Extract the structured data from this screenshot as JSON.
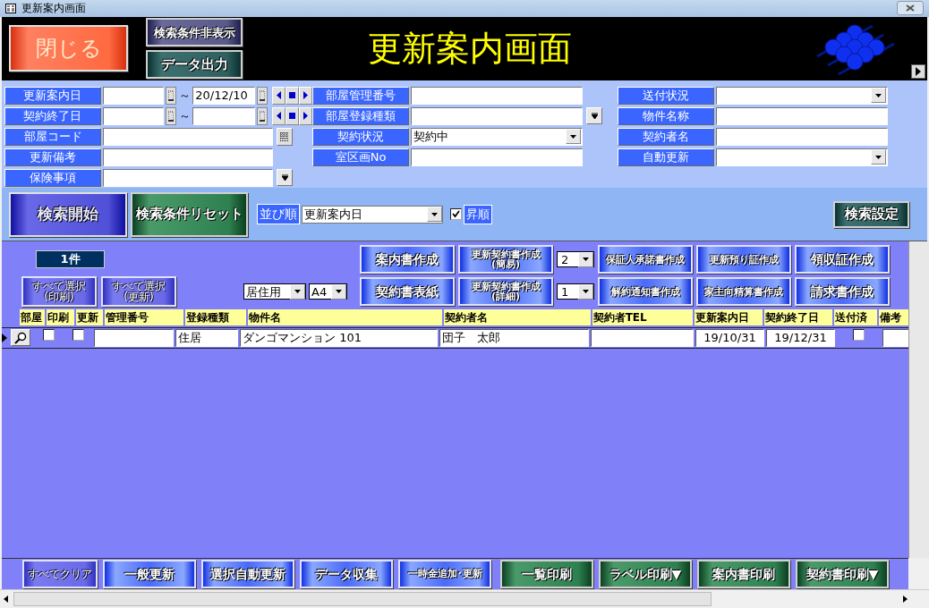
{
  "window": {
    "title": "更新案内画面"
  },
  "header": {
    "title": "更新案内画面",
    "buttons": [
      {
        "label": "閉じる",
        "kind": "red"
      },
      {
        "label": "検索条件非表示",
        "kind": "navy"
      },
      {
        "label": "データ出力",
        "kind": "teal"
      }
    ]
  },
  "form": {
    "left": [
      {
        "label": "更新案内日",
        "kind": "date_range",
        "separator": "～",
        "to": "20/12/10"
      },
      {
        "label": "契約終了日",
        "kind": "date_range",
        "separator": "～"
      },
      {
        "label": "部屋コード",
        "kind": "lookup"
      },
      {
        "label": "更新備考",
        "kind": "text"
      },
      {
        "label": "保険事項",
        "kind": "multi"
      }
    ],
    "middle": [
      {
        "label": "部屋管理番号",
        "kind": "text"
      },
      {
        "label": "部屋登録種類",
        "kind": "multi"
      },
      {
        "label": "契約状況",
        "kind": "combo",
        "value": "契約中"
      },
      {
        "label": "室区画No",
        "kind": "text"
      }
    ],
    "right": [
      {
        "label": "送付状況",
        "kind": "combo"
      },
      {
        "label": "物件名称",
        "kind": "text"
      },
      {
        "label": "契約者名",
        "kind": "text"
      },
      {
        "label": "自動更新",
        "kind": "combo"
      }
    ]
  },
  "search_bar": {
    "start": "検索開始",
    "reset": "検索条件リセット",
    "sort_label": "並び順",
    "sort_value": "更新案内日",
    "ascending": {
      "label": "昇順",
      "checked": true
    },
    "settings": "検索設定"
  },
  "results": {
    "count": "1件",
    "select_all": [
      "すべて選択\n(印刷)",
      "すべて選択\n(更新)"
    ],
    "usage": "居住用",
    "paper": "A4",
    "actions_row1": [
      {
        "label": "案内書作成"
      },
      {
        "label": "更新契約書作成\n(簡易)",
        "copies": "2"
      },
      {
        "label": "保証人承諾書作成"
      },
      {
        "label": "更新預り証作成"
      },
      {
        "label": "領収証作成"
      }
    ],
    "actions_row2": [
      {
        "label": "契約書表紙"
      },
      {
        "label": "更新契約書作成\n(詳細)",
        "copies": "1"
      },
      {
        "label": "解約通知書作成"
      },
      {
        "label": "家主向精算書作成"
      },
      {
        "label": "請求書作成"
      }
    ]
  },
  "table": {
    "columns": [
      {
        "label": "部屋",
        "kind": "lookup"
      },
      {
        "label": "印刷",
        "kind": "check"
      },
      {
        "label": "更新",
        "kind": "check"
      },
      {
        "label": "管理番号",
        "kind": "text"
      },
      {
        "label": "登録種類",
        "kind": "text"
      },
      {
        "label": "物件名",
        "kind": "text"
      },
      {
        "label": "契約者名",
        "kind": "text"
      },
      {
        "label": "契約者TEL",
        "kind": "text"
      },
      {
        "label": "更新案内日",
        "kind": "date"
      },
      {
        "label": "契約終了日",
        "kind": "date"
      },
      {
        "label": "送付済",
        "kind": "check"
      },
      {
        "label": "備考",
        "kind": "text"
      }
    ],
    "rows": [
      {
        "current": true,
        "cells": [
          {},
          {
            "checked": false
          },
          {
            "checked": false
          },
          {},
          {
            "text": "住居"
          },
          {
            "text": "ダンゴマンション 101"
          },
          {
            "text": "団子　太郎"
          },
          {},
          {
            "text": "19/10/31"
          },
          {
            "text": "19/12/31"
          },
          {
            "checked": false
          },
          {}
        ]
      }
    ]
  },
  "bottom_buttons": [
    {
      "label": "すべてクリア",
      "kind": "violet"
    },
    {
      "label": "一般更新",
      "kind": "blue"
    },
    {
      "label": "選択自動更新",
      "kind": "blue"
    },
    {
      "label": "データ収集",
      "kind": "blue"
    },
    {
      "label": "一時金追加･更新",
      "kind": "blue"
    },
    {
      "label": "一覧印刷",
      "kind": "green"
    },
    {
      "label": "ラベル印刷▼",
      "kind": "green"
    },
    {
      "label": "案内書印刷",
      "kind": "green"
    },
    {
      "label": "契約書印刷▼",
      "kind": "green"
    }
  ]
}
